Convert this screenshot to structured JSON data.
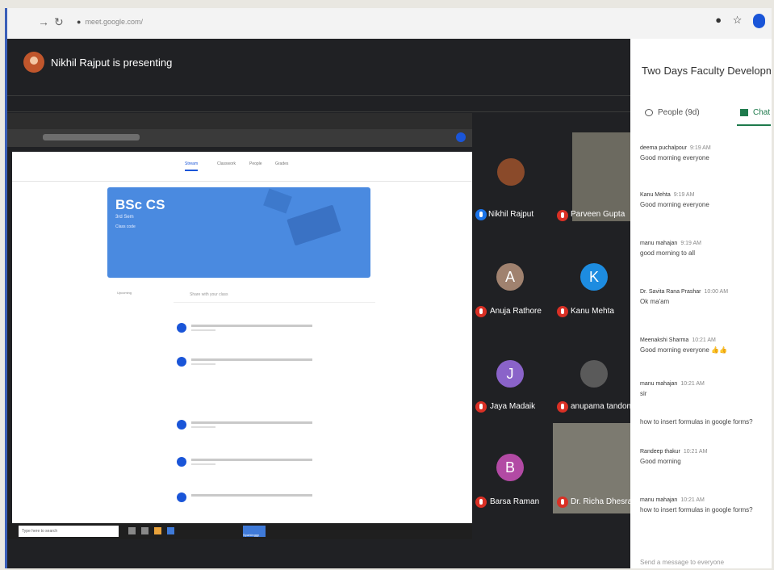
{
  "browser": {
    "url": "meet.google.com/",
    "back_icon": "arrow-right-icon",
    "reload_icon": "reload-icon",
    "star_icon": "star-icon"
  },
  "meet": {
    "presenter_text": "Nikhil Rajput is presenting",
    "participants": [
      {
        "name": "Nikhil Rajput",
        "initial": "",
        "color": "#8a4a2a"
      },
      {
        "name": "Parveen Gupta",
        "initial": "",
        "color": "#6c6a60"
      },
      {
        "name": "Anuja Rathore",
        "initial": "A",
        "color": "#a0826f"
      },
      {
        "name": "Kanu Mehta",
        "initial": "K",
        "color": "#1d8ce0"
      },
      {
        "name": "Jaya Madaik",
        "initial": "J",
        "color": "#8a63c9"
      },
      {
        "name": "anupama tandon",
        "initial": "",
        "color": "#5a5a5a"
      },
      {
        "name": "Barsa Raman",
        "initial": "B",
        "color": "#b24aa4"
      },
      {
        "name": "Dr. Richa Dhesra",
        "initial": "",
        "color": "#7c7a70"
      }
    ]
  },
  "shared": {
    "tabs": [
      "Stream",
      "Classwork",
      "People",
      "Grades"
    ],
    "class_title": "BSc CS",
    "class_sub": "3rd Sem",
    "class_code": "Class code",
    "upcoming": "Upcoming",
    "post_placeholder": "Share with your class",
    "taskbar_search": "Type here to search",
    "taskbar_button": "Sparkinggy"
  },
  "panel": {
    "title": "Two Days Faculty Developm...",
    "tab_people": "People (9d)",
    "tab_chat": "Chat",
    "messages": [
      {
        "sender": "deema puchalpour",
        "time": "9:19 AM",
        "text": "Good morning everyone"
      },
      {
        "sender": "Kanu Mehta",
        "time": "9:19 AM",
        "text": "Good morning everyone"
      },
      {
        "sender": "manu mahajan",
        "time": "9:19 AM",
        "text": "good morning to all"
      },
      {
        "sender": "Dr. Savita Rana Prashar",
        "time": "10:00 AM",
        "text": "Ok ma'am"
      },
      {
        "sender": "Meenakshi Sharma",
        "time": "10:21 AM",
        "text": "Good morning everyone 👍👍"
      },
      {
        "sender": "manu mahajan",
        "time": "10:21 AM",
        "text": "sir"
      },
      {
        "sender": "",
        "time": "",
        "text": "how to insert formulas in google forms?"
      },
      {
        "sender": "Randeep thakur",
        "time": "10:21 AM",
        "text": "Good morning"
      },
      {
        "sender": "manu mahajan",
        "time": "10:21 AM",
        "text": "how to insert formulas in google forms?"
      }
    ],
    "send_placeholder": "Send a message to everyone"
  }
}
